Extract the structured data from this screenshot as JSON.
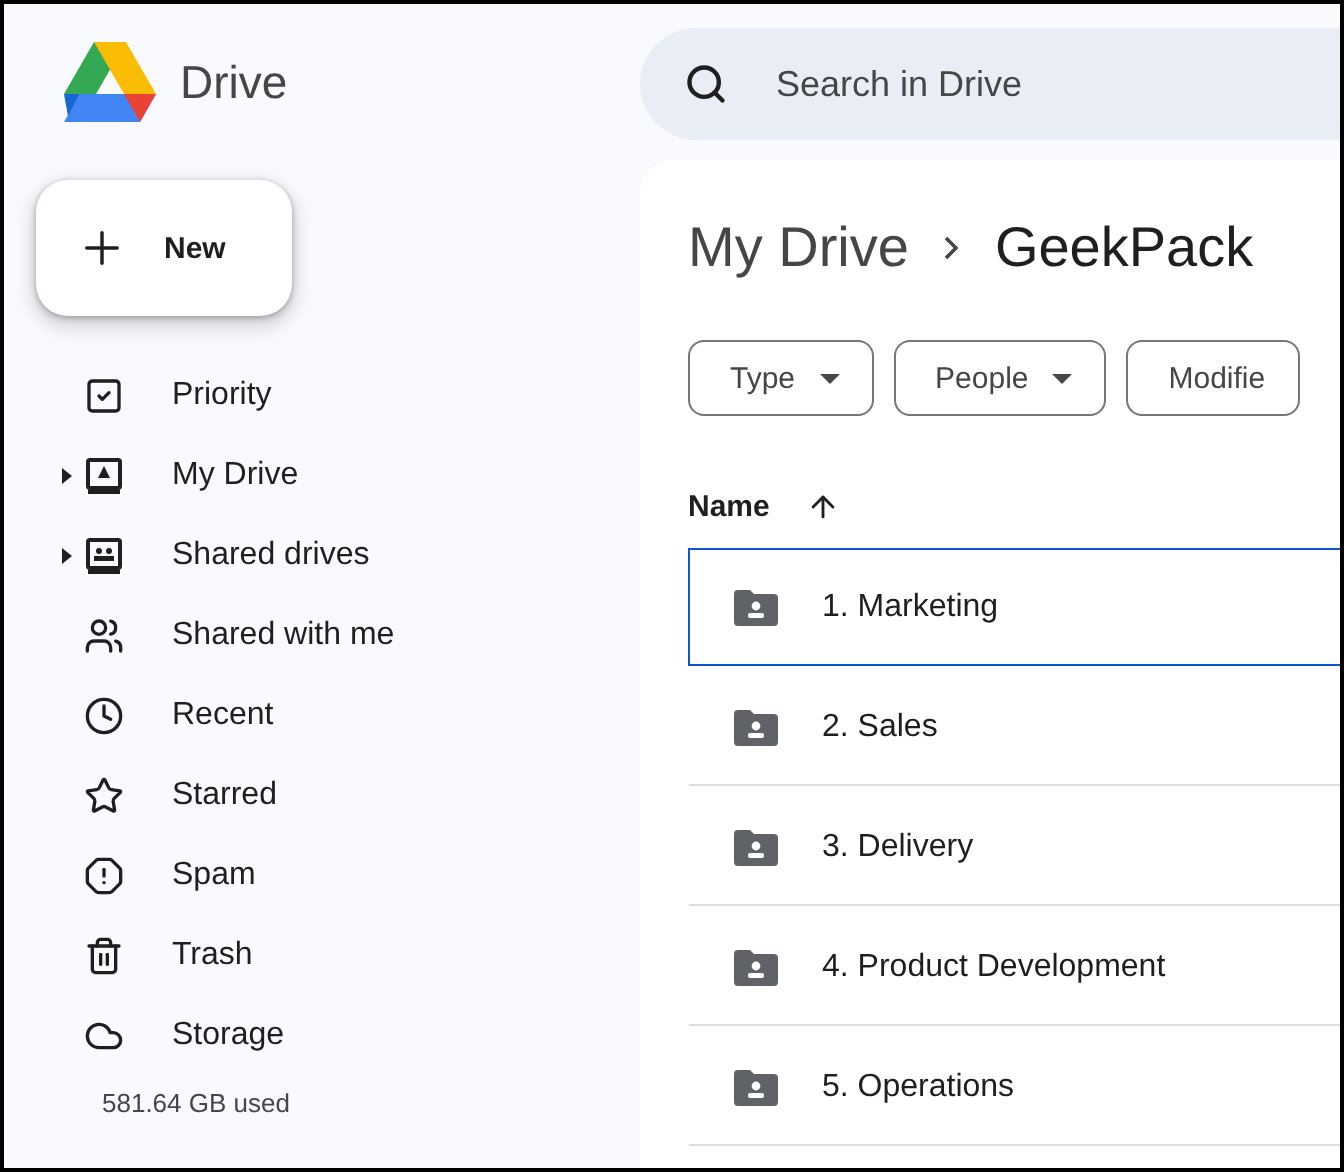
{
  "app": {
    "name": "Drive"
  },
  "new_button": {
    "label": "New"
  },
  "sidebar": {
    "items": [
      {
        "label": "Priority",
        "has_children": false
      },
      {
        "label": "My Drive",
        "has_children": true
      },
      {
        "label": "Shared drives",
        "has_children": true
      },
      {
        "label": "Shared with me",
        "has_children": false
      },
      {
        "label": "Recent",
        "has_children": false
      },
      {
        "label": "Starred",
        "has_children": false
      },
      {
        "label": "Spam",
        "has_children": false
      },
      {
        "label": "Trash",
        "has_children": false
      },
      {
        "label": "Storage",
        "has_children": false
      }
    ],
    "storage_used": "581.64 GB used"
  },
  "search": {
    "placeholder": "Search in Drive"
  },
  "breadcrumb": [
    "My Drive",
    "GeekPack"
  ],
  "filters": [
    {
      "label": "Type",
      "dropdown": true
    },
    {
      "label": "People",
      "dropdown": true
    },
    {
      "label": "Modifie",
      "dropdown": false
    }
  ],
  "table": {
    "columns": [
      {
        "label": "Name",
        "sorted_ascending": true
      }
    ],
    "rows": [
      {
        "name": "1. Marketing",
        "selected": true
      },
      {
        "name": "2. Sales",
        "selected": false
      },
      {
        "name": "3. Delivery",
        "selected": false
      },
      {
        "name": "4. Product Development",
        "selected": false
      },
      {
        "name": "5. Operations",
        "selected": false
      }
    ]
  }
}
